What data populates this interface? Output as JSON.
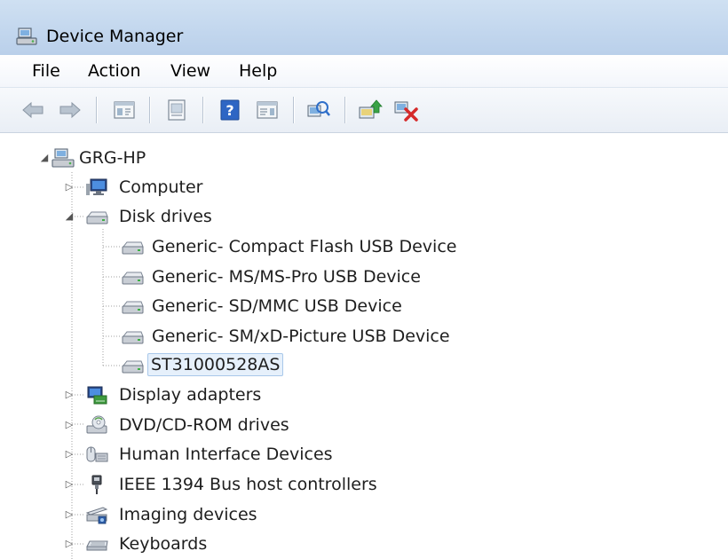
{
  "window": {
    "title": "Device Manager",
    "icon": "device-manager-icon"
  },
  "menu": {
    "file": "File",
    "action": "Action",
    "view": "View",
    "help": "Help"
  },
  "toolbar": {
    "buttons": [
      "back-arrow-icon",
      "forward-arrow-icon",
      "show-hide-console-tree-icon",
      "properties-icon",
      "help-icon",
      "action-pane-icon",
      "scan-hardware-changes-icon",
      "update-driver-icon",
      "uninstall-device-icon"
    ]
  },
  "tree": {
    "root": {
      "label": "GRG-HP",
      "expanded": true
    },
    "computer": {
      "label": "Computer",
      "expanded": false
    },
    "disk_drives": {
      "label": "Disk drives",
      "expanded": true,
      "children": [
        "Generic- Compact Flash USB Device",
        "Generic- MS/MS-Pro USB Device",
        "Generic- SD/MMC USB Device",
        "Generic- SM/xD-Picture USB Device",
        "ST31000528AS"
      ],
      "selected": "ST31000528AS"
    },
    "display_adapters": {
      "label": "Display adapters",
      "expanded": false
    },
    "dvd_cdrom": {
      "label": "DVD/CD-ROM drives",
      "expanded": false
    },
    "hid": {
      "label": "Human Interface Devices",
      "expanded": false
    },
    "ieee1394": {
      "label": "IEEE 1394 Bus host controllers",
      "expanded": false
    },
    "imaging": {
      "label": "Imaging devices",
      "expanded": false
    },
    "keyboards": {
      "label": "Keyboards",
      "expanded": false
    }
  },
  "colors": {
    "selection_bg": "#e6f0fb",
    "selection_border": "#a9c8ea",
    "title_bar": "#c3d7ee"
  }
}
